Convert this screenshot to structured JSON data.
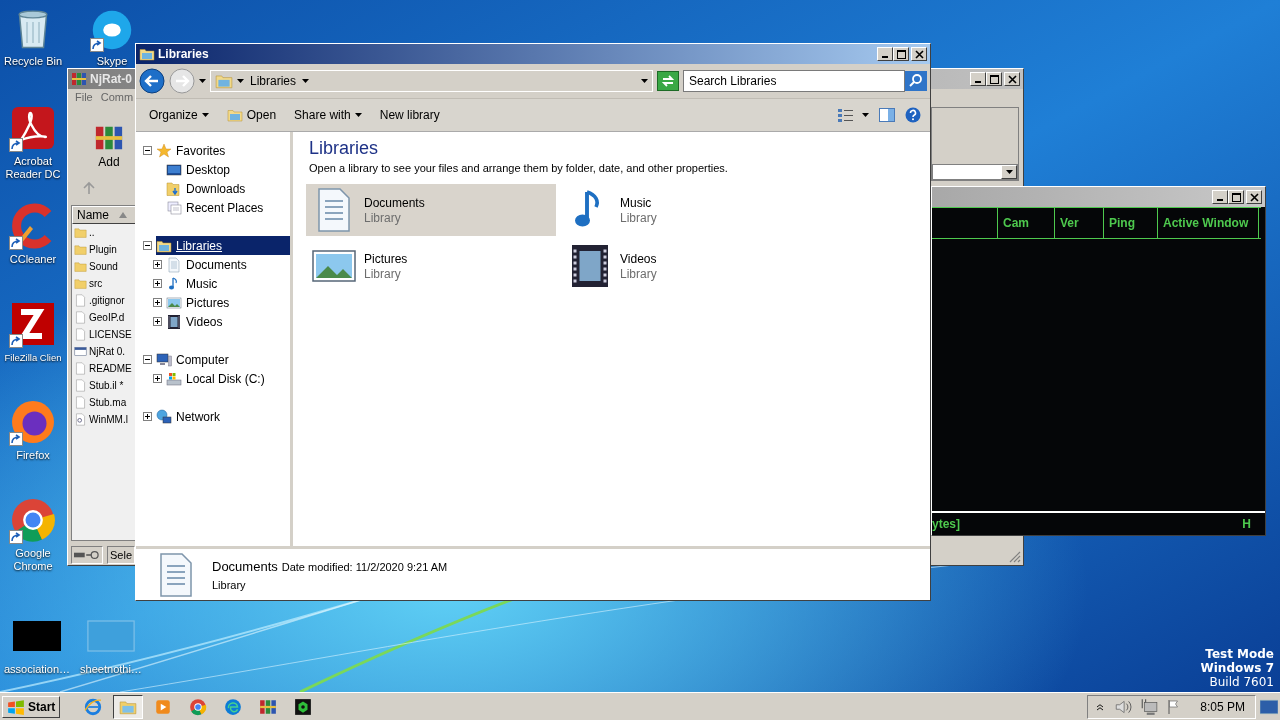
{
  "desktop_icons": [
    {
      "label": "Recycle Bin",
      "kind": "recycle",
      "shortcut": false
    },
    {
      "label": "Skype",
      "kind": "skype",
      "shortcut": true
    },
    {
      "label": "Acrobat Reader DC",
      "kind": "acrobat",
      "shortcut": true
    },
    {
      "label": "CCleaner",
      "kind": "ccleaner",
      "shortcut": true
    },
    {
      "label": "FileZilla Clien",
      "kind": "filezilla",
      "shortcut": true
    },
    {
      "label": "Firefox",
      "kind": "firefox",
      "shortcut": true
    },
    {
      "label": "Google Chrome",
      "kind": "chrome",
      "shortcut": true
    },
    {
      "label": "association…",
      "kind": "dark_thumb",
      "shortcut": false
    },
    {
      "label": "sheetnothi…",
      "kind": "blank_thumb",
      "shortcut": false
    }
  ],
  "editor_window": {
    "title": "NjRat-0",
    "menu": [
      "File",
      "Comm"
    ],
    "toolbar_button": "Add",
    "column": "Name",
    "files": [
      {
        "name": "..",
        "kind": "folder"
      },
      {
        "name": "Plugin",
        "kind": "folder"
      },
      {
        "name": "Sound",
        "kind": "folder"
      },
      {
        "name": "src",
        "kind": "folder"
      },
      {
        "name": ".gitignor",
        "kind": "file"
      },
      {
        "name": "GeoIP.d",
        "kind": "file"
      },
      {
        "name": "LICENSE",
        "kind": "file"
      },
      {
        "name": "NjRat 0.",
        "kind": "program"
      },
      {
        "name": "README",
        "kind": "file"
      },
      {
        "name": "Stub.il *",
        "kind": "file"
      },
      {
        "name": "Stub.ma",
        "kind": "file"
      },
      {
        "name": "WinMM.l",
        "kind": "settings_file"
      }
    ],
    "status": "Sele"
  },
  "njrat_window": {
    "columns": [
      "Cam",
      "Ver",
      "Ping",
      "Active Window"
    ],
    "status_left": "ytes]",
    "status_right": "H"
  },
  "explorer": {
    "title": "Libraries",
    "address": "Libraries",
    "search": {
      "placeholder": "Search Libraries"
    },
    "toolbar": [
      {
        "label": "Organize",
        "kind": "menu"
      },
      {
        "label": "Open",
        "kind": "open"
      },
      {
        "label": "Share with",
        "kind": "menu"
      },
      {
        "label": "New library",
        "kind": "plain"
      }
    ],
    "nav": [
      {
        "label": "Favorites",
        "kind": "star",
        "expanded": true,
        "selected": false,
        "children": [
          {
            "label": "Desktop",
            "kind": "desktop",
            "selected": false
          },
          {
            "label": "Downloads",
            "kind": "download",
            "selected": false
          },
          {
            "label": "Recent Places",
            "kind": "recent",
            "selected": false
          }
        ]
      },
      {
        "label": "Libraries",
        "kind": "library",
        "expanded": true,
        "selected": true,
        "children": [
          {
            "label": "Documents",
            "kind": "document",
            "expanded": false,
            "selected": false
          },
          {
            "label": "Music",
            "kind": "music",
            "expanded": false,
            "selected": false
          },
          {
            "label": "Pictures",
            "kind": "picture",
            "expanded": false,
            "selected": false
          },
          {
            "label": "Videos",
            "kind": "video",
            "expanded": false,
            "selected": false
          }
        ]
      },
      {
        "label": "Computer",
        "kind": "computer",
        "expanded": true,
        "selected": false,
        "children": [
          {
            "label": "Local Disk (C:)",
            "kind": "disk",
            "expanded": false,
            "selected": false
          }
        ]
      },
      {
        "label": "Network",
        "kind": "network",
        "expanded": false,
        "selected": false
      }
    ],
    "heading": "Libraries",
    "description": "Open a library to see your files and arrange them by folder, date, and other properties.",
    "libraries": [
      {
        "name": "Documents",
        "type": "Library",
        "kind": "document",
        "selected": true
      },
      {
        "name": "Music",
        "type": "Library",
        "kind": "music",
        "selected": false
      },
      {
        "name": "Pictures",
        "type": "Library",
        "kind": "picture",
        "selected": false
      },
      {
        "name": "Videos",
        "type": "Library",
        "kind": "video",
        "selected": false
      }
    ],
    "details": {
      "name": "Documents",
      "meta": "Date modified: 11/2/2020 9:21 AM",
      "type": "Library",
      "kind": "document"
    }
  },
  "os_notice": [
    {
      "text": "Test Mode",
      "bold": true
    },
    {
      "text": "Windows 7",
      "bold": true
    },
    {
      "text": "Build 7601",
      "bold": false
    }
  ],
  "taskbar": {
    "start": "Start",
    "apps": [
      {
        "kind": "ie",
        "selected": false
      },
      {
        "kind": "explorer",
        "selected": true
      },
      {
        "kind": "media",
        "selected": false
      },
      {
        "kind": "chrome",
        "selected": false
      },
      {
        "kind": "edge",
        "selected": false
      },
      {
        "kind": "winrar",
        "selected": false
      },
      {
        "kind": "njrat",
        "selected": false
      }
    ],
    "clock": "8:05 PM"
  }
}
